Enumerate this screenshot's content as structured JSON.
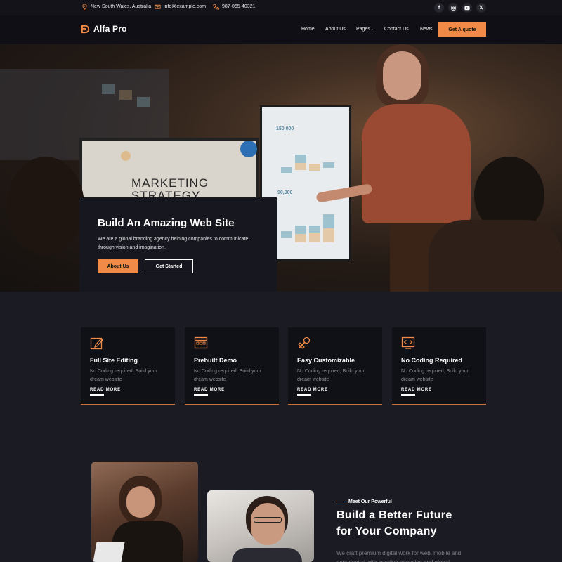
{
  "topbar": {
    "location": "New South Wales, Australia",
    "email": "info@example.com",
    "phone": "987-065-40321",
    "socials": [
      "facebook-icon",
      "instagram-icon",
      "youtube-icon",
      "x-icon"
    ]
  },
  "nav": {
    "logo_text": "Alfa Pro",
    "items": [
      "Home",
      "About Us",
      "Pages",
      "Contact Us",
      "News"
    ],
    "cta": "Get A quote"
  },
  "hero": {
    "screen_text_1": "MARKETING",
    "screen_text_2": "STRATEGY",
    "screen_num_1": "150,000",
    "screen_num_2": "90,000",
    "title": "Build An Amazing Web Site",
    "text": "We are a global branding agency helping companies to communicate through vision and imagination.",
    "btn_primary": "About Us",
    "btn_secondary": "Get Started"
  },
  "features": [
    {
      "title": "Full Site Editing",
      "desc": "No Coding required, Build your dream website",
      "more": "READ MORE",
      "icon": "edit-icon"
    },
    {
      "title": "Prebuilt Demo",
      "desc": "No Coding required, Build your dream website",
      "more": "READ MORE",
      "icon": "layout-icon"
    },
    {
      "title": "Easy Customizable",
      "desc": "No Coding required, Build your dream website",
      "more": "READ MORE",
      "icon": "tools-icon"
    },
    {
      "title": "No Coding Required",
      "desc": "No Coding required, Build your dream website",
      "more": "READ MORE",
      "icon": "code-icon"
    }
  ],
  "about": {
    "eyebrow": "Meet Our Powerful",
    "title_line1": "Build a Better Future",
    "title_line2": "for Your Company",
    "text": "We craft premium digital work for web, mobile and experiential with creative agencies and global"
  },
  "colors": {
    "accent": "#f08a46",
    "background": "#1b1b23",
    "card": "#101017"
  }
}
